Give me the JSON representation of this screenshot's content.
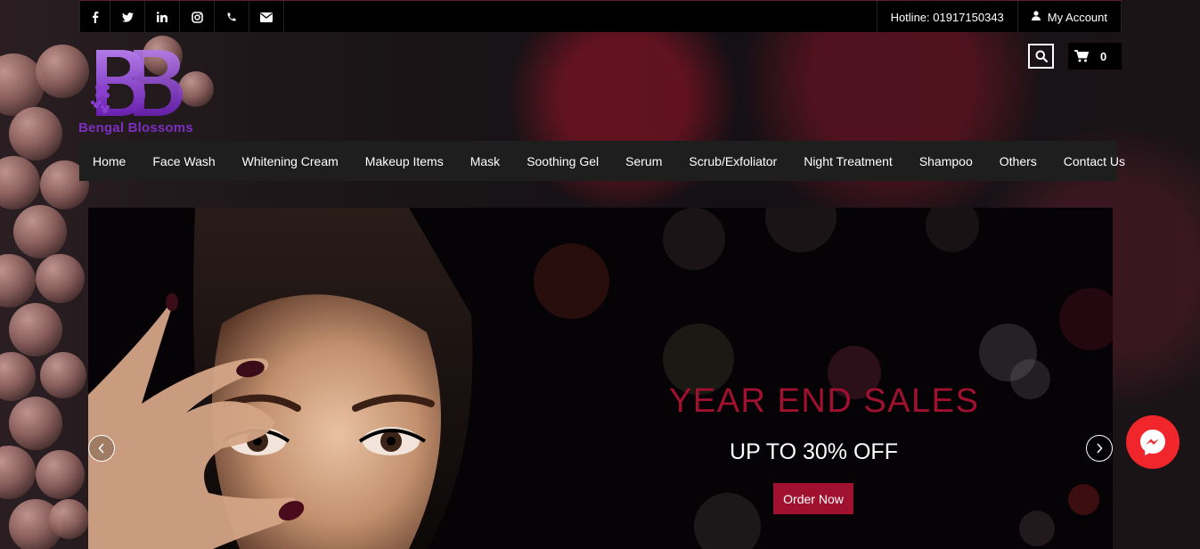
{
  "brand": {
    "name": "Bengal Blossoms",
    "colors": {
      "accent": "#a0112f",
      "logo": "#7b2fbf",
      "messenger": "#f0262c"
    }
  },
  "topbar": {
    "social": [
      {
        "name": "facebook-icon",
        "glyph": "f"
      },
      {
        "name": "twitter-icon",
        "glyph": "t"
      },
      {
        "name": "linkedin-icon",
        "glyph": "in"
      },
      {
        "name": "instagram-icon",
        "glyph": "ig"
      },
      {
        "name": "phone-icon",
        "glyph": "ph"
      },
      {
        "name": "envelope-icon",
        "glyph": "env"
      }
    ],
    "hotline": "Hotline: 01917150343",
    "account": "My Account"
  },
  "cart": {
    "count": "0"
  },
  "nav": {
    "items": [
      "Home",
      "Face Wash",
      "Whitening Cream",
      "Makeup Items",
      "Mask",
      "Soothing Gel",
      "Serum",
      "Scrub/Exfoliator",
      "Night Treatment",
      "Shampoo",
      "Others",
      "Contact Us"
    ]
  },
  "slider": {
    "headline": "YEAR END SALES",
    "subline": "UP TO 30% OFF",
    "button": "Order Now",
    "prev_icon": "chevron-left-icon",
    "next_icon": "chevron-right-icon"
  },
  "widgets": {
    "messenger_icon": "messenger-icon"
  }
}
